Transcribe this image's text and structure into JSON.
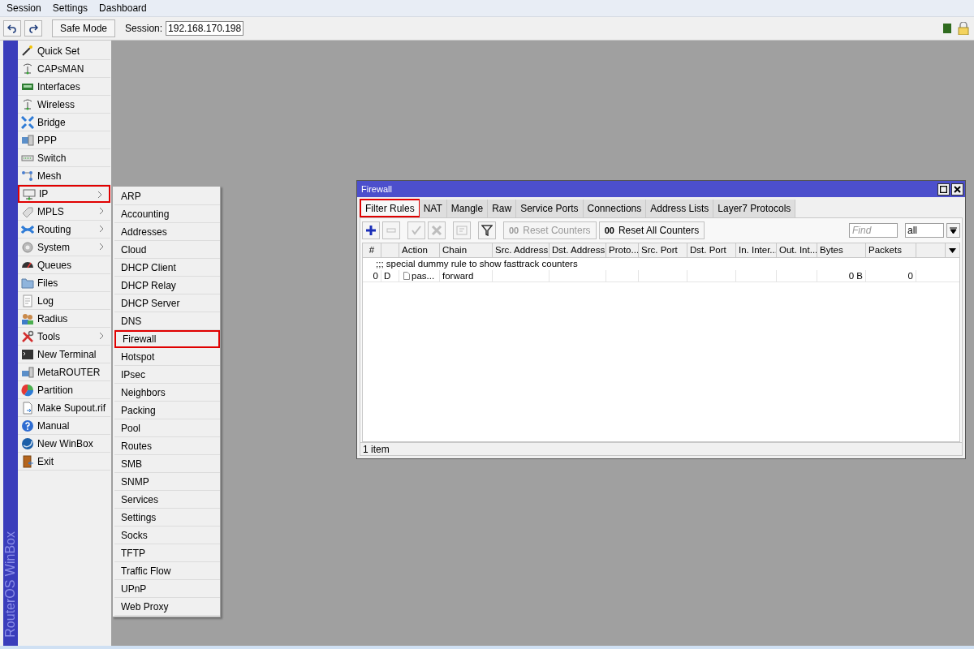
{
  "menubar": [
    "Session",
    "Settings",
    "Dashboard"
  ],
  "toolbar": {
    "safe_mode": "Safe Mode",
    "session_label": "Session:",
    "session_value": "192.168.170.198"
  },
  "side_label": "RouterOS WinBox",
  "sidebar": {
    "items": [
      {
        "label": "Quick Set",
        "has_submenu": false,
        "highlighted": false
      },
      {
        "label": "CAPsMAN",
        "has_submenu": false,
        "highlighted": false
      },
      {
        "label": "Interfaces",
        "has_submenu": false,
        "highlighted": false
      },
      {
        "label": "Wireless",
        "has_submenu": false,
        "highlighted": false
      },
      {
        "label": "Bridge",
        "has_submenu": false,
        "highlighted": false
      },
      {
        "label": "PPP",
        "has_submenu": false,
        "highlighted": false
      },
      {
        "label": "Switch",
        "has_submenu": false,
        "highlighted": false
      },
      {
        "label": "Mesh",
        "has_submenu": false,
        "highlighted": false
      },
      {
        "label": "IP",
        "has_submenu": true,
        "highlighted": true
      },
      {
        "label": "MPLS",
        "has_submenu": true,
        "highlighted": false
      },
      {
        "label": "Routing",
        "has_submenu": true,
        "highlighted": false
      },
      {
        "label": "System",
        "has_submenu": true,
        "highlighted": false
      },
      {
        "label": "Queues",
        "has_submenu": false,
        "highlighted": false
      },
      {
        "label": "Files",
        "has_submenu": false,
        "highlighted": false
      },
      {
        "label": "Log",
        "has_submenu": false,
        "highlighted": false
      },
      {
        "label": "Radius",
        "has_submenu": false,
        "highlighted": false
      },
      {
        "label": "Tools",
        "has_submenu": true,
        "highlighted": false
      },
      {
        "label": "New Terminal",
        "has_submenu": false,
        "highlighted": false
      },
      {
        "label": "MetaROUTER",
        "has_submenu": false,
        "highlighted": false
      },
      {
        "label": "Partition",
        "has_submenu": false,
        "highlighted": false
      },
      {
        "label": "Make Supout.rif",
        "has_submenu": false,
        "highlighted": false
      },
      {
        "label": "Manual",
        "has_submenu": false,
        "highlighted": false
      },
      {
        "label": "New WinBox",
        "has_submenu": false,
        "highlighted": false
      },
      {
        "label": "Exit",
        "has_submenu": false,
        "highlighted": false
      }
    ]
  },
  "submenu": {
    "items": [
      {
        "label": "ARP",
        "highlighted": false
      },
      {
        "label": "Accounting",
        "highlighted": false
      },
      {
        "label": "Addresses",
        "highlighted": false
      },
      {
        "label": "Cloud",
        "highlighted": false
      },
      {
        "label": "DHCP Client",
        "highlighted": false
      },
      {
        "label": "DHCP Relay",
        "highlighted": false
      },
      {
        "label": "DHCP Server",
        "highlighted": false
      },
      {
        "label": "DNS",
        "highlighted": false
      },
      {
        "label": "Firewall",
        "highlighted": true
      },
      {
        "label": "Hotspot",
        "highlighted": false
      },
      {
        "label": "IPsec",
        "highlighted": false
      },
      {
        "label": "Neighbors",
        "highlighted": false
      },
      {
        "label": "Packing",
        "highlighted": false
      },
      {
        "label": "Pool",
        "highlighted": false
      },
      {
        "label": "Routes",
        "highlighted": false
      },
      {
        "label": "SMB",
        "highlighted": false
      },
      {
        "label": "SNMP",
        "highlighted": false
      },
      {
        "label": "Services",
        "highlighted": false
      },
      {
        "label": "Settings",
        "highlighted": false
      },
      {
        "label": "Socks",
        "highlighted": false
      },
      {
        "label": "TFTP",
        "highlighted": false
      },
      {
        "label": "Traffic Flow",
        "highlighted": false
      },
      {
        "label": "UPnP",
        "highlighted": false
      },
      {
        "label": "Web Proxy",
        "highlighted": false
      }
    ]
  },
  "window": {
    "title": "Firewall",
    "tabs": [
      {
        "label": "Filter Rules",
        "selected": true,
        "highlighted": true
      },
      {
        "label": "NAT",
        "selected": false,
        "highlighted": false
      },
      {
        "label": "Mangle",
        "selected": false,
        "highlighted": false
      },
      {
        "label": "Raw",
        "selected": false,
        "highlighted": false
      },
      {
        "label": "Service Ports",
        "selected": false,
        "highlighted": false
      },
      {
        "label": "Connections",
        "selected": false,
        "highlighted": false
      },
      {
        "label": "Address Lists",
        "selected": false,
        "highlighted": false
      },
      {
        "label": "Layer7 Protocols",
        "selected": false,
        "highlighted": false
      }
    ],
    "tools": [
      {
        "kind": "add",
        "disabled": false
      },
      {
        "kind": "remove",
        "disabled": true
      },
      {
        "kind": "enable",
        "disabled": true
      },
      {
        "kind": "disable",
        "disabled": true
      },
      {
        "kind": "comment",
        "disabled": true
      },
      {
        "kind": "filter",
        "disabled": false
      }
    ],
    "counter_buttons": [
      {
        "prefix": "00",
        "label": "Reset Counters",
        "disabled": true
      },
      {
        "prefix": "00",
        "label": "Reset All Counters",
        "disabled": false
      }
    ],
    "find": {
      "placeholder": "Find"
    },
    "filter_select": {
      "value": "all"
    },
    "table": {
      "columns": [
        "#",
        "Action",
        "Chain",
        "Src. Address",
        "Dst. Address",
        "Proto...",
        "Src. Port",
        "Dst. Port",
        "In. Inter...",
        "Out. Int...",
        "Bytes",
        "Packets"
      ],
      "rows": [
        {
          "comment": ";;; special dummy rule to show fasttrack counters",
          "number": "0",
          "flag": "D",
          "action": "pas...",
          "chain": "forward",
          "bytes": "0 B",
          "packets": "0"
        }
      ]
    },
    "status_bar": "1 item"
  }
}
